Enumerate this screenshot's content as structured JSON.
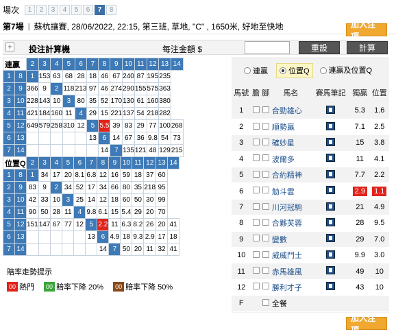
{
  "race_selector": {
    "label": "場次",
    "numbers": [
      "1",
      "2",
      "3",
      "4",
      "5",
      "6",
      "7",
      "8"
    ],
    "active_index": 6
  },
  "race": {
    "title": "第7場",
    "separator": "|",
    "info": "蘇杭讓賽, 28/06/2022, 22:15, 第三班, 草地, \"C\" , 1650米, 好地至快地"
  },
  "add_bet_label": "加入注項",
  "calculator": {
    "title": "投注計算機",
    "unit_label": "每注金額 $",
    "unit_value": "",
    "reset_label": "重設",
    "calc_label": "計算"
  },
  "quinella": {
    "label": "連贏",
    "cols": [
      "2",
      "3",
      "4",
      "5",
      "6",
      "7",
      "8",
      "9",
      "10",
      "11",
      "12",
      "13",
      "14"
    ],
    "rows": [
      {
        "h": "1",
        "cells": [
          "8",
          "1",
          "153",
          "63",
          "68",
          "28",
          "18",
          "46",
          "67",
          "240",
          "87",
          "195",
          "235"
        ],
        "diag": 1,
        "hot": []
      },
      {
        "h": "2",
        "cells": [
          "9",
          "366",
          "9",
          "2",
          "118",
          "213",
          "97",
          "46",
          "274",
          "290",
          "155",
          "575",
          "363"
        ],
        "diag": 3,
        "hot": []
      },
      {
        "h": "3",
        "cells": [
          "10",
          "228",
          "143",
          "10",
          "3",
          "80",
          "35",
          "52",
          "170",
          "130",
          "61",
          "160",
          "380"
        ],
        "diag": 4,
        "hot": []
      },
      {
        "h": "4",
        "cells": [
          "11",
          "421",
          "184",
          "160",
          "11",
          "4",
          "29",
          "15",
          "221",
          "137",
          "54",
          "218",
          "282"
        ],
        "diag": 5,
        "hot": []
      },
      {
        "h": "5",
        "cells": [
          "12",
          "649",
          "579",
          "258",
          "310",
          "12",
          "5",
          "5.5",
          "39",
          "83",
          "29",
          "77",
          "100",
          "268"
        ],
        "diag": 6,
        "hot": [
          7
        ]
      },
      {
        "h": "6",
        "cells": [
          "13",
          "",
          "",
          "",
          "",
          "",
          "13",
          "6",
          "14",
          "67",
          "36",
          "9.8",
          "54",
          "73"
        ],
        "diag": 7,
        "hot": []
      },
      {
        "h": "7",
        "cells": [
          "14",
          "",
          "",
          "",
          "",
          "",
          "",
          "14",
          "7",
          "135",
          "121",
          "48",
          "129",
          "215"
        ],
        "diag": 8,
        "hot": []
      }
    ]
  },
  "place_q": {
    "label": "位置Q",
    "cols": [
      "2",
      "3",
      "4",
      "5",
      "6",
      "7",
      "8",
      "9",
      "10",
      "11",
      "12",
      "13",
      "14"
    ],
    "rows": [
      {
        "h": "1",
        "cells": [
          "8",
          "1",
          "34",
          "17",
          "20",
          "8.1",
          "6.8",
          "12",
          "16",
          "59",
          "18",
          "37",
          "60"
        ],
        "diag": 1,
        "hot": []
      },
      {
        "h": "2",
        "cells": [
          "9",
          "83",
          "9",
          "2",
          "34",
          "52",
          "17",
          "34",
          "66",
          "80",
          "35",
          "218",
          "95"
        ],
        "diag": 3,
        "hot": []
      },
      {
        "h": "3",
        "cells": [
          "10",
          "42",
          "33",
          "10",
          "3",
          "25",
          "14",
          "12",
          "18",
          "60",
          "50",
          "30",
          "99"
        ],
        "diag": 4,
        "hot": []
      },
      {
        "h": "4",
        "cells": [
          "11",
          "90",
          "50",
          "28",
          "11",
          "4",
          "9.8",
          "6.1",
          "15",
          "5.4",
          "29",
          "20",
          "70"
        ],
        "diag": 5,
        "hot": []
      },
      {
        "h": "5",
        "cells": [
          "12",
          "151",
          "147",
          "67",
          "77",
          "12",
          "5",
          "2.2",
          "11",
          "6.3",
          "8.2",
          "26",
          "20",
          "41"
        ],
        "diag": 6,
        "hot": [
          7
        ]
      },
      {
        "h": "6",
        "cells": [
          "13",
          "",
          "",
          "",
          "",
          "",
          "13",
          "6",
          "4.9",
          "18",
          "9.3",
          "2.9",
          "17",
          "18"
        ],
        "diag": 7,
        "hot": []
      },
      {
        "h": "7",
        "cells": [
          "14",
          "",
          "",
          "",
          "",
          "",
          "",
          "14",
          "7",
          "50",
          "20",
          "11",
          "32",
          "41"
        ],
        "diag": 8,
        "hot": []
      }
    ]
  },
  "legend": {
    "title": "賠率走勢提示",
    "items": [
      {
        "chip": "00",
        "color": "#e0231b",
        "text": "熱門"
      },
      {
        "chip": "00",
        "color": "#3aa63a",
        "text": "賠率下降 20%"
      },
      {
        "chip": "00",
        "color": "#8a4a1a",
        "text": "賠率下降 50%"
      }
    ]
  },
  "bet_types": {
    "options": [
      "連贏",
      "位置Q",
      "連贏及位置Q"
    ],
    "selected_index": 1
  },
  "horse_table": {
    "headers": [
      "馬號",
      "膽",
      "腳",
      "馬名",
      "賽馬筆記",
      "獨贏",
      "位置"
    ],
    "rows": [
      {
        "no": "1",
        "name": "合勁雄心",
        "win": "5.3",
        "place": "1.6",
        "hot": false
      },
      {
        "no": "2",
        "name": "順勢贏",
        "win": "7.1",
        "place": "2.5",
        "hot": false
      },
      {
        "no": "3",
        "name": "確妙星",
        "win": "15",
        "place": "3.8",
        "hot": false
      },
      {
        "no": "4",
        "name": "波爾多",
        "win": "11",
        "place": "4.1",
        "hot": false
      },
      {
        "no": "5",
        "name": "合約精神",
        "win": "7.7",
        "place": "2.2",
        "hot": false
      },
      {
        "no": "6",
        "name": "觔斗雲",
        "win": "2.9",
        "place": "1.1",
        "hot": true
      },
      {
        "no": "7",
        "name": "川河冠駒",
        "win": "21",
        "place": "4.9",
        "hot": false
      },
      {
        "no": "8",
        "name": "合夥芙蓉",
        "win": "28",
        "place": "9.5",
        "hot": false
      },
      {
        "no": "9",
        "name": "變數",
        "win": "29",
        "place": "7.0",
        "hot": false
      },
      {
        "no": "10",
        "name": "威威鬥士",
        "win": "9.9",
        "place": "3.0",
        "hot": false
      },
      {
        "no": "11",
        "name": "赤馬雄風",
        "win": "49",
        "place": "10",
        "hot": false
      },
      {
        "no": "12",
        "name": "勝利才子",
        "win": "43",
        "place": "10",
        "hot": false
      }
    ],
    "field_row": {
      "no": "F",
      "name": "全餐"
    }
  }
}
